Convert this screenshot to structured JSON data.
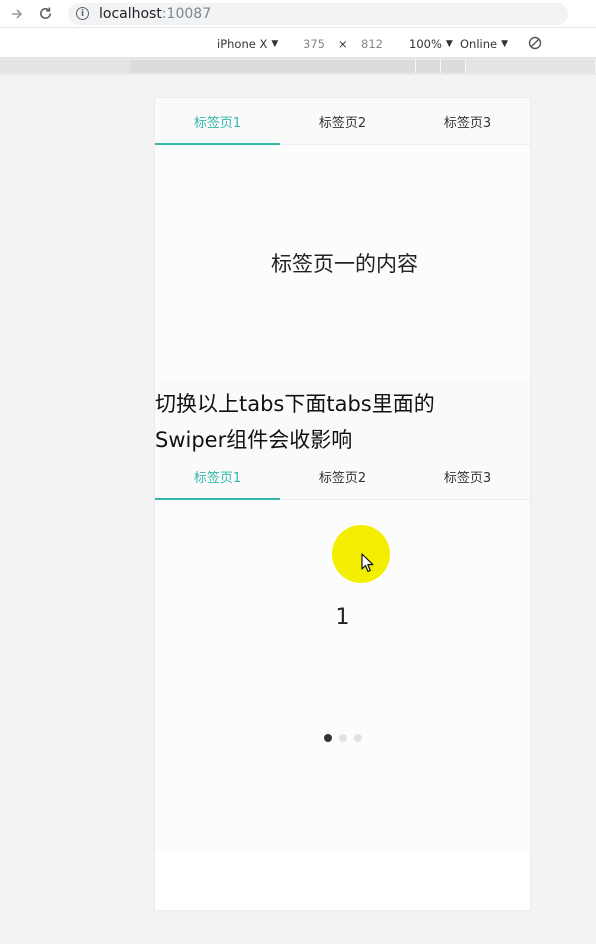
{
  "browser": {
    "url_host": "localhost",
    "url_port": ":10087"
  },
  "device_toolbar": {
    "device": "iPhone X",
    "width": "375",
    "times": "×",
    "height": "812",
    "zoom": "100%",
    "network": "Online"
  },
  "top_tabs": [
    {
      "label": "标签页1",
      "active": true
    },
    {
      "label": "标签页2",
      "active": false
    },
    {
      "label": "标签页3",
      "active": false
    }
  ],
  "tab_content": "标签页一的内容",
  "description": {
    "line1": "切换以上tabs下面tabs里面的",
    "line2": "Swiper组件会收影响"
  },
  "inner_tabs": [
    {
      "label": "标签页1",
      "active": true
    },
    {
      "label": "标签页2",
      "active": false
    },
    {
      "label": "标签页3",
      "active": false
    }
  ],
  "swiper": {
    "current_slide": "1",
    "dot_count": 3,
    "active_dot": 0
  },
  "colors": {
    "accent": "#34b7a9",
    "cursor_highlight": "#f4ee00"
  }
}
